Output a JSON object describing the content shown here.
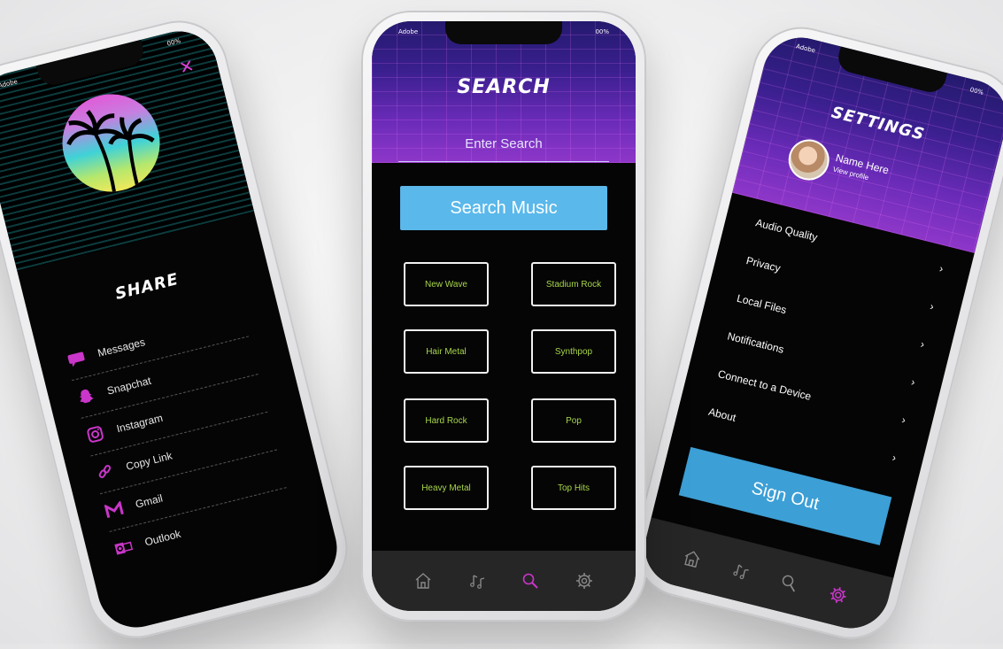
{
  "center": {
    "status_left": "Adobe",
    "status_right": "00%",
    "title": "SEARCH",
    "search_placeholder": "Enter Search",
    "search_button": "Search Music",
    "genres": [
      "New Wave",
      "Stadium Rock",
      "Hair Metal",
      "Synthpop",
      "Hard Rock",
      "Pop",
      "Heavy Metal",
      "Top Hits"
    ],
    "tabs": [
      {
        "icon": "home-icon"
      },
      {
        "icon": "music-icon"
      },
      {
        "icon": "search-icon",
        "active": true
      },
      {
        "icon": "gear-icon"
      }
    ],
    "colors": {
      "accent": "#c936c9",
      "genre_text": "#a8d64a",
      "button": "#5ab8ea"
    }
  },
  "left": {
    "status_left": "Adobe",
    "status_right": "00%",
    "title": "SHARE",
    "items": [
      {
        "label": "Messages",
        "icon": "messages-icon"
      },
      {
        "label": "Snapchat",
        "icon": "snapchat-icon"
      },
      {
        "label": "Instagram",
        "icon": "instagram-icon"
      },
      {
        "label": "Copy Link",
        "icon": "link-icon"
      },
      {
        "label": "Gmail",
        "icon": "gmail-icon"
      },
      {
        "label": "Outlook",
        "icon": "outlook-icon"
      }
    ]
  },
  "right": {
    "status_left": "Adobe",
    "status_right": "00%",
    "title": "SETTINGS",
    "profile_name": "Name Here",
    "profile_link": "View profile",
    "items": [
      "Audio Quality",
      "Privacy",
      "Local Files",
      "Notifications",
      "Connect to a Device",
      "About"
    ],
    "chevron": "›",
    "sign_out": "Sign Out",
    "tabs": [
      {
        "icon": "home-icon"
      },
      {
        "icon": "music-icon"
      },
      {
        "icon": "search-icon"
      },
      {
        "icon": "gear-icon",
        "active": true
      }
    ]
  }
}
